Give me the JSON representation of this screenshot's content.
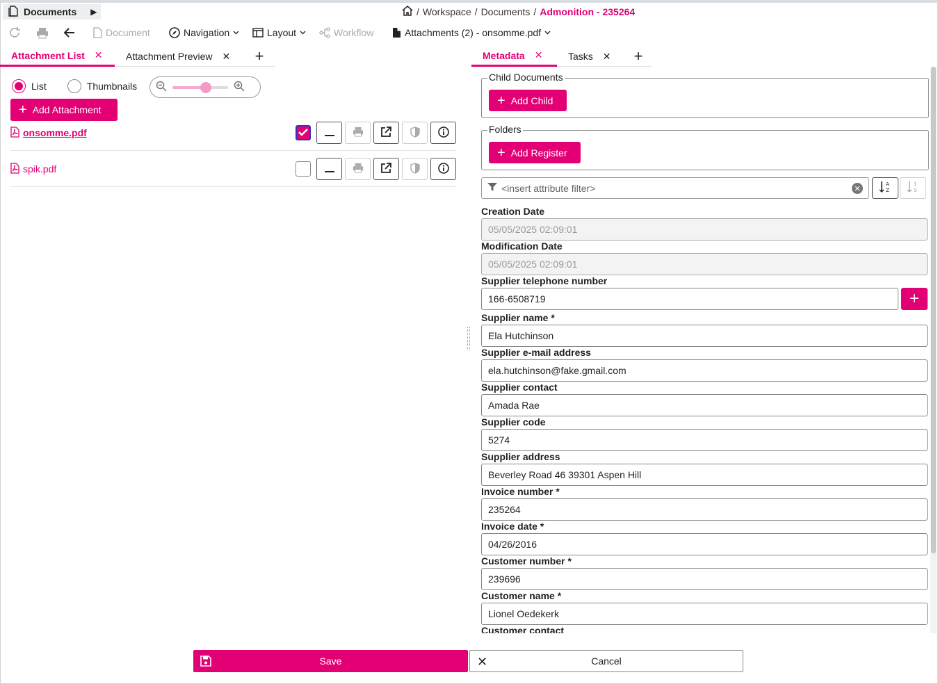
{
  "header": {
    "app_title": "Documents",
    "breadcrumb": [
      "Workspace",
      "Documents"
    ],
    "breadcrumb_current": "Admonition - 235264"
  },
  "toolbar": {
    "document_label": "Document",
    "navigation_label": "Navigation",
    "layout_label": "Layout",
    "workflow_label": "Workflow",
    "attachments_label": "Attachments (2) - onsomme.pdf"
  },
  "left_tabs": [
    {
      "label": "Attachment List",
      "active": true
    },
    {
      "label": "Attachment Preview",
      "active": false
    }
  ],
  "right_tabs": [
    {
      "label": "Metadata",
      "active": true
    },
    {
      "label": "Tasks",
      "active": false
    }
  ],
  "attachments_panel": {
    "view_list_label": "List",
    "view_thumbnails_label": "Thumbnails",
    "zoom_level": 0.6,
    "add_attachment_label": "Add Attachment",
    "items": [
      {
        "name": "onsomme.pdf",
        "checked": true
      },
      {
        "name": "spik.pdf",
        "checked": false
      }
    ]
  },
  "metadata": {
    "child_documents_legend": "Child Documents",
    "add_child_label": "Add Child",
    "folders_legend": "Folders",
    "add_register_label": "Add Register",
    "filter_placeholder": "<insert attribute filter>",
    "fields": [
      {
        "label": "Creation Date",
        "value": "05/05/2025 02:09:01",
        "readonly": true
      },
      {
        "label": "Modification Date",
        "value": "05/05/2025 02:09:01",
        "readonly": true
      },
      {
        "label": "Supplier telephone number",
        "value": "166-6508719",
        "multi": true
      },
      {
        "label": "Supplier name *",
        "value": "Ela Hutchinson"
      },
      {
        "label": "Supplier e-mail address",
        "value": "ela.hutchinson@fake.gmail.com"
      },
      {
        "label": "Supplier contact",
        "value": "Amada Rae"
      },
      {
        "label": "Supplier code",
        "value": "5274"
      },
      {
        "label": "Supplier address",
        "value": "Beverley Road 46 39301 Aspen Hill"
      },
      {
        "label": "Invoice number *",
        "value": "235264"
      },
      {
        "label": "Invoice date *",
        "value": "04/26/2016"
      },
      {
        "label": "Customer number *",
        "value": "239696"
      },
      {
        "label": "Customer name *",
        "value": "Lionel Oedekerk"
      },
      {
        "label": "Customer contact",
        "value": ""
      }
    ]
  },
  "footer": {
    "save_label": "Save",
    "cancel_label": "Cancel"
  },
  "colors": {
    "accent": "#e20074",
    "checkbox_border": "#3b31b5"
  }
}
